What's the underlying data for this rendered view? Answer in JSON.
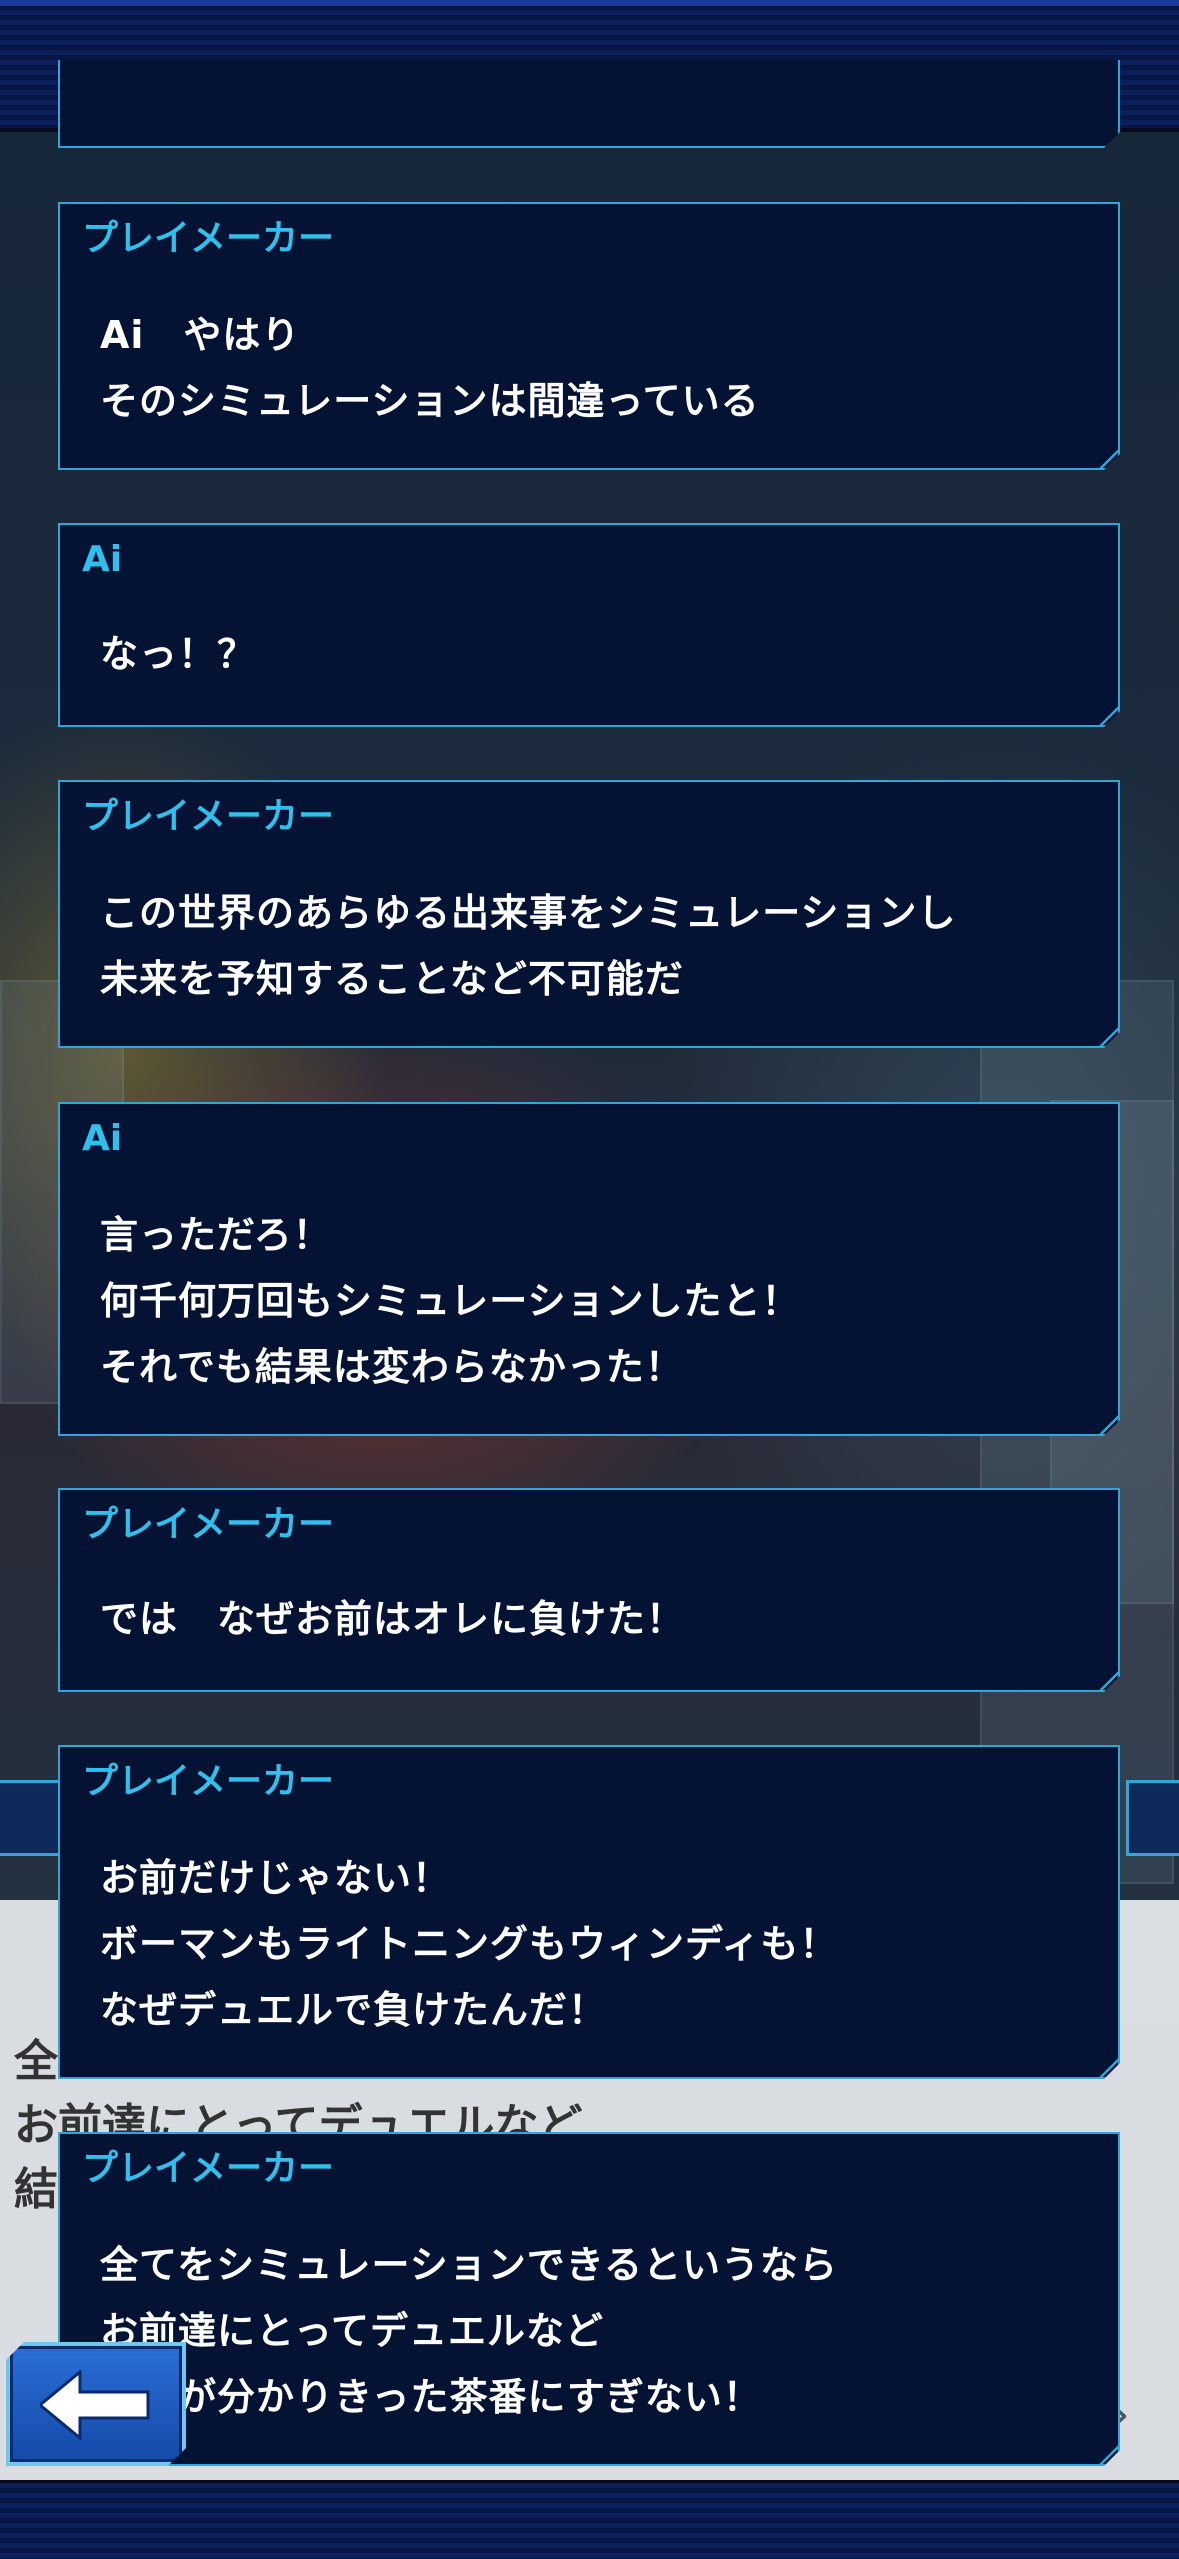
{
  "messages": [
    {
      "speaker": "プレイメーカー",
      "text": "Ai　やはり\nそのシミュレーションは間違っている"
    },
    {
      "speaker": "Ai",
      "text": "なっ！？"
    },
    {
      "speaker": "プレイメーカー",
      "text": "この世界のあらゆる出来事をシミュレーションし\n未来を予知することなど不可能だ"
    },
    {
      "speaker": "Ai",
      "text": "言っただろ！\n何千何万回もシミュレーションしたと！\nそれでも結果は変わらなかった！"
    },
    {
      "speaker": "プレイメーカー",
      "text": "では　なぜお前はオレに負けた！"
    },
    {
      "speaker": "プレイメーカー",
      "text": "お前だけじゃない！\nボーマンもライトニングもウィンディも！\nなぜデュエルで負けたんだ！"
    },
    {
      "speaker": "プレイメーカー",
      "text": "全てをシミュレーションできるというなら\nお前達にとってデュエルなど\n結果が分かりきった茶番にすぎない！"
    }
  ],
  "underlying_text": "全\nお前達にとってデュエルなど\n結",
  "back_button": {
    "icon": "arrow-left-icon"
  },
  "colors": {
    "speaker": "#2fc0ee",
    "border": "#2ea6d9",
    "panel": "#041233",
    "text": "#ffffff"
  }
}
